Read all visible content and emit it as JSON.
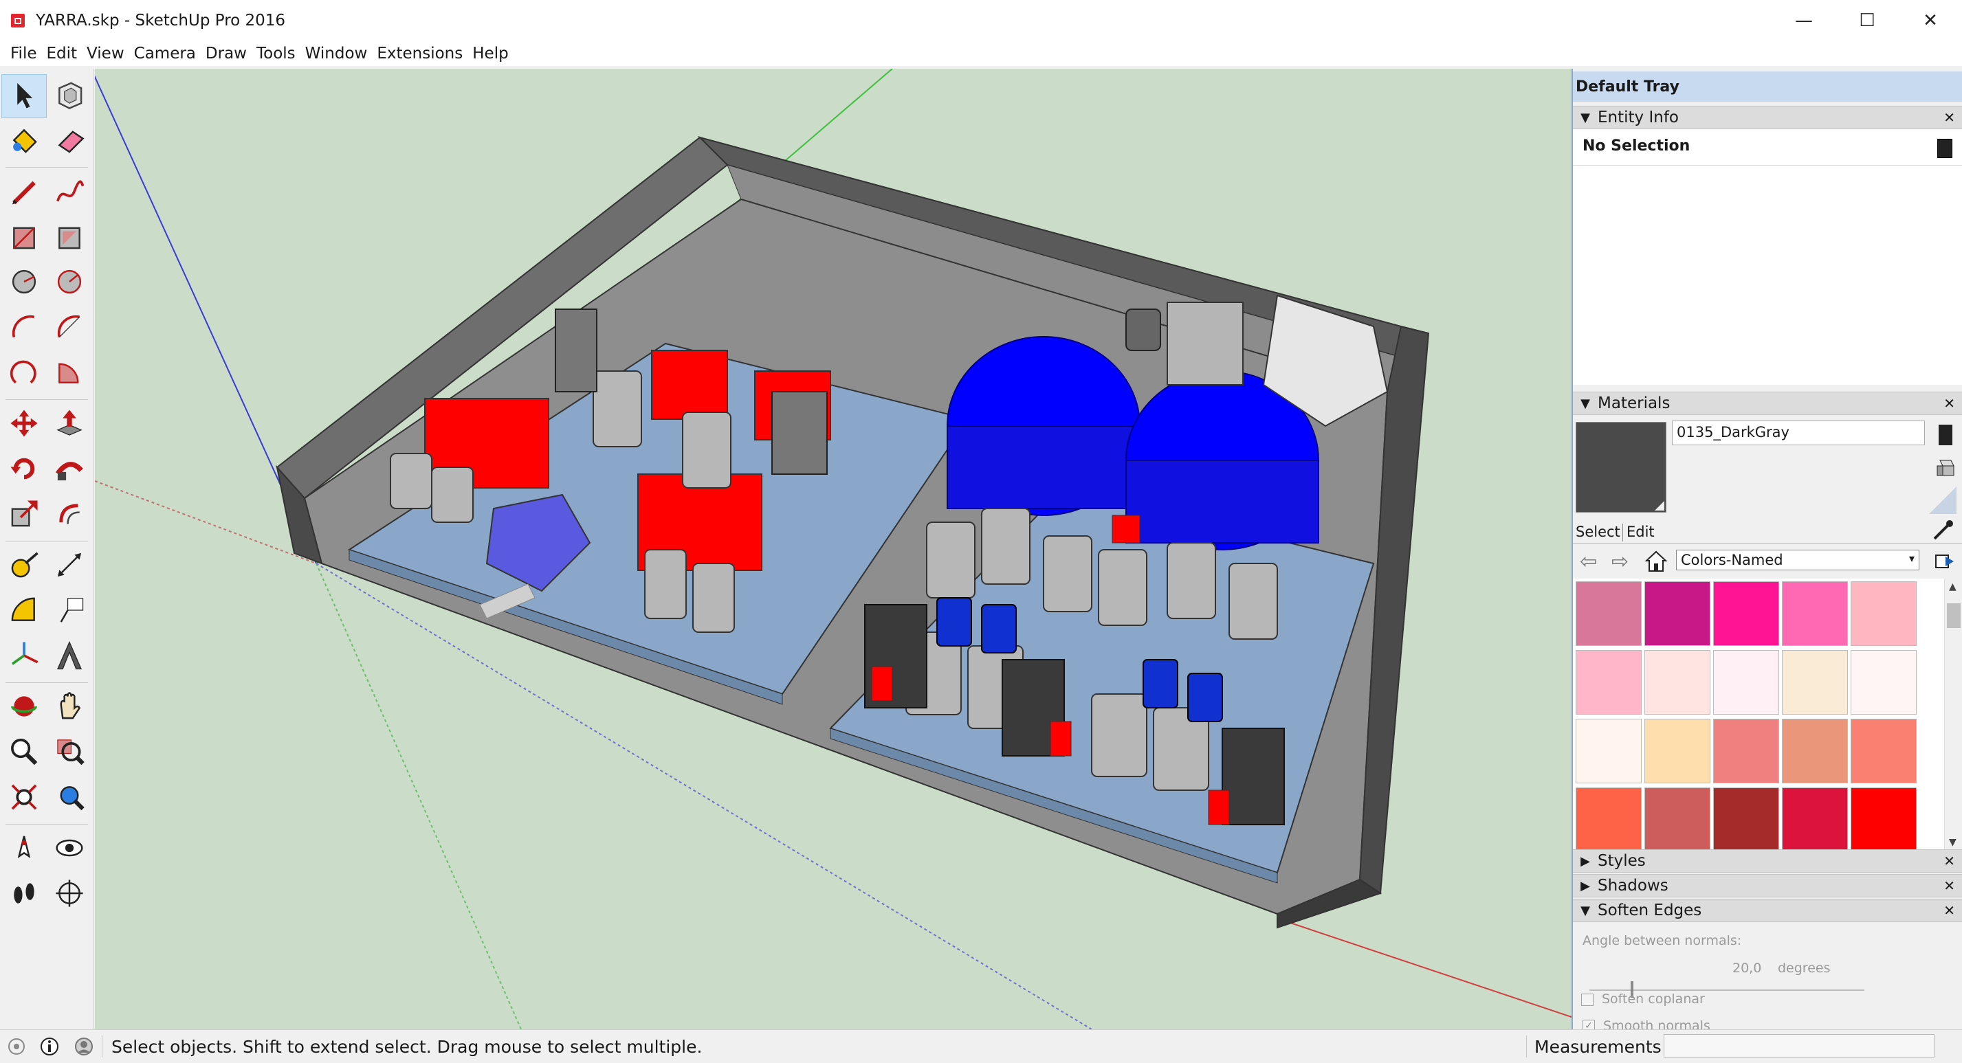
{
  "window": {
    "title": "YARRA.skp - SketchUp Pro 2016",
    "minimize_glyph": "—",
    "maximize_glyph": "☐",
    "close_glyph": "✕"
  },
  "menu": [
    "File",
    "Edit",
    "View",
    "Camera",
    "Draw",
    "Tools",
    "Window",
    "Extensions",
    "Help"
  ],
  "toolbar": {
    "tools": [
      [
        "select-icon",
        "make-component-icon"
      ],
      [
        "paint-bucket-icon",
        "eraser-icon"
      ],
      [
        "pencil-icon",
        "freehand-icon"
      ],
      [
        "rectangle-icon",
        "rotated-rectangle-icon"
      ],
      [
        "circle-icon",
        "polygon-icon"
      ],
      [
        "arc-icon",
        "two-point-arc-icon"
      ],
      [
        "three-point-arc-icon",
        "pie-icon"
      ],
      [
        "move-icon",
        "push-pull-icon"
      ],
      [
        "rotate-icon",
        "follow-me-icon"
      ],
      [
        "scale-icon",
        "offset-icon"
      ],
      [
        "tape-measure-icon",
        "dimension-icon"
      ],
      [
        "protractor-icon",
        "text-icon"
      ],
      [
        "axes-icon",
        "3d-text-icon"
      ],
      [
        "orbit-icon",
        "pan-icon"
      ],
      [
        "zoom-icon",
        "zoom-window-icon"
      ],
      [
        "zoom-extents-icon",
        "previous-view-icon"
      ],
      [
        "position-camera-icon",
        "look-around-icon"
      ],
      [
        "walk-icon",
        "section-plane-icon"
      ]
    ]
  },
  "tray": {
    "title": "Default Tray",
    "entity_info": {
      "header": "Entity Info",
      "selection": "No Selection"
    },
    "materials": {
      "header": "Materials",
      "current_name": "0135_DarkGray",
      "current_color": "#4a4a4a",
      "tab_select": "Select",
      "tab_edit": "Edit",
      "library": "Colors-Named",
      "swatches": [
        "#d9779a",
        "#c81887",
        "#ff1493",
        "#ff69b4",
        "#ffb6c1",
        "#ffb6c8",
        "#ffe4e1",
        "#fff0f5",
        "#faebd7",
        "#fff5f5",
        "#fff5ee",
        "#ffdead",
        "#f08080",
        "#e9967a",
        "#fa8072",
        "#ff6347",
        "#cd5c5c",
        "#a52a2a",
        "#dc143c",
        "#ff0000"
      ]
    },
    "styles": {
      "header": "Styles"
    },
    "shadows": {
      "header": "Shadows"
    },
    "soften_edges": {
      "header": "Soften Edges",
      "angle_label": "Angle between normals:",
      "angle_value": "20,0",
      "angle_unit": "degrees",
      "slider_fraction": 0.15,
      "smooth_normals": "Smooth normals",
      "soften_coplanar": "Soften coplanar"
    }
  },
  "status": {
    "text": "Select objects. Shift to extend select. Drag mouse to select multiple.",
    "measurements_label": "Measurements",
    "measurements_value": ""
  }
}
